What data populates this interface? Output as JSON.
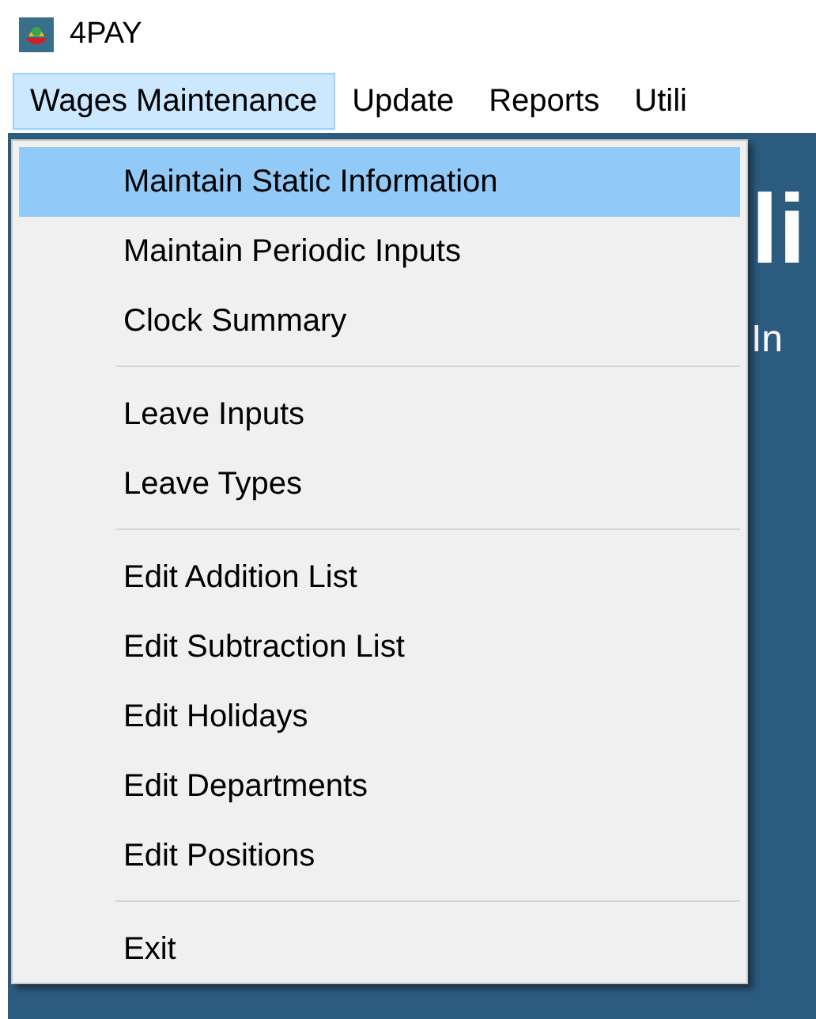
{
  "window": {
    "title": "4PAY"
  },
  "menu_bar": [
    {
      "label": "Wages Maintenance",
      "selected": true
    },
    {
      "label": "Update",
      "selected": false
    },
    {
      "label": "Reports",
      "selected": false
    },
    {
      "label": "Utili",
      "selected": false
    }
  ],
  "dropdown": {
    "sections": [
      {
        "items": [
          {
            "label": "Maintain Static Information",
            "selected": true
          },
          {
            "label": "Maintain Periodic Inputs",
            "selected": false
          },
          {
            "label": "Clock Summary",
            "selected": false
          }
        ]
      },
      {
        "items": [
          {
            "label": "Leave Inputs",
            "selected": false
          },
          {
            "label": "Leave Types",
            "selected": false
          }
        ]
      },
      {
        "items": [
          {
            "label": "Edit Addition List",
            "selected": false
          },
          {
            "label": "Edit Subtraction List",
            "selected": false
          },
          {
            "label": "Edit Holidays",
            "selected": false
          },
          {
            "label": "Edit Departments",
            "selected": false
          },
          {
            "label": "Edit Positions",
            "selected": false
          }
        ]
      },
      {
        "items": [
          {
            "label": "Exit",
            "selected": false
          }
        ]
      }
    ]
  },
  "background": {
    "heading": "li",
    "subheading": "In"
  }
}
